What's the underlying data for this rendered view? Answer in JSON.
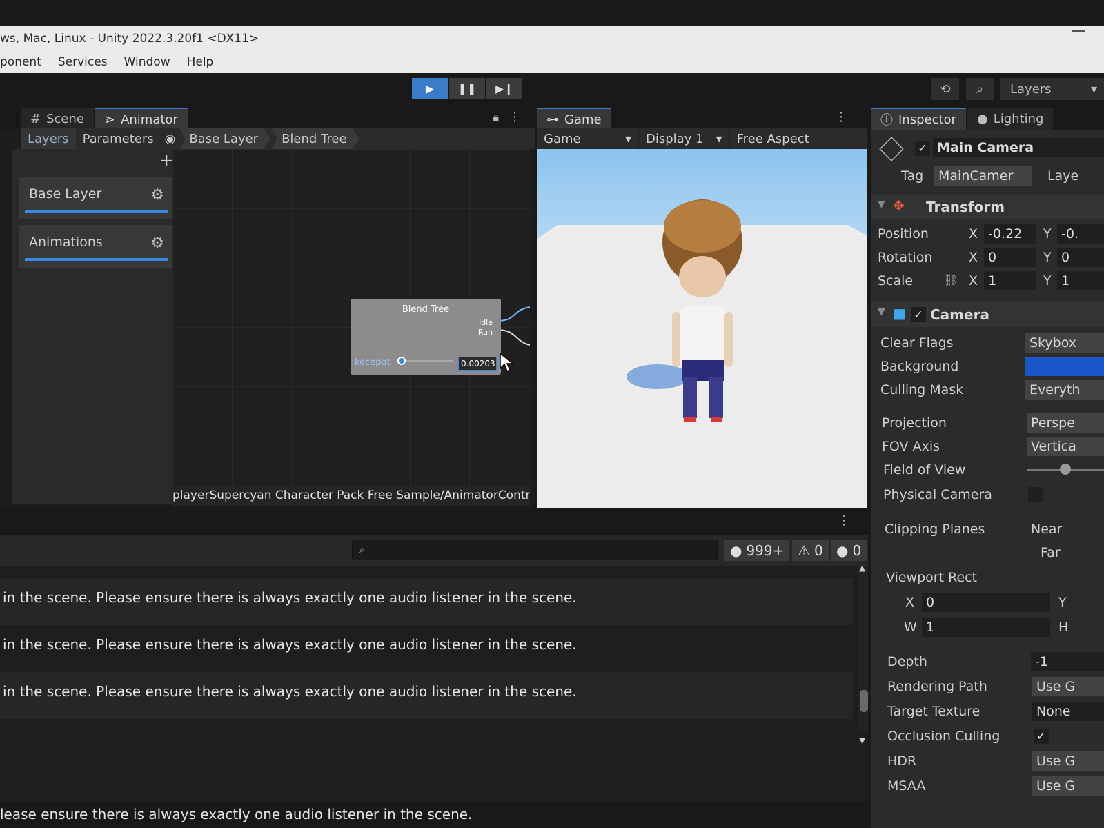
{
  "window": {
    "title": "ws, Mac, Linux - Unity 2022.3.20f1 <DX11>"
  },
  "menu": [
    "ponent",
    "Services",
    "Window",
    "Help"
  ],
  "toolbar": {
    "layers_label": "Layers"
  },
  "animator": {
    "tabs": [
      "Scene",
      "Animator"
    ],
    "subtabs": [
      "Layers",
      "Parameters"
    ],
    "breadcrumbs": [
      "Base Layer",
      "Blend Tree"
    ],
    "layers": [
      "Base Layer",
      "Animations"
    ],
    "node": {
      "title": "Blend Tree",
      "outputs": [
        "Idle",
        "Run"
      ],
      "param_name": "kecepat",
      "param_value": "0.00203"
    },
    "path": "playerSupercyan Character Pack Free Sample/AnimatorContr"
  },
  "game": {
    "tab": "Game",
    "mode": "Game",
    "display": "Display 1",
    "aspect": "Free Aspect"
  },
  "inspector": {
    "tabs": [
      "Inspector",
      "Lighting"
    ],
    "object_name": "Main Camera",
    "tag_label": "Tag",
    "tag_value": "MainCamer",
    "layer_label": "Laye",
    "transform": {
      "title": "Transform",
      "position": {
        "label": "Position",
        "x": "-0.22",
        "y": "-0."
      },
      "rotation": {
        "label": "Rotation",
        "x": "0",
        "y": "0"
      },
      "scale": {
        "label": "Scale",
        "x": "1",
        "y": "1"
      }
    },
    "camera": {
      "title": "Camera",
      "clear_flags": {
        "label": "Clear Flags",
        "value": "Skybox"
      },
      "background": {
        "label": "Background",
        "color": "#1a56c8"
      },
      "culling_mask": {
        "label": "Culling Mask",
        "value": "Everyth"
      },
      "projection": {
        "label": "Projection",
        "value": "Perspe"
      },
      "fov_axis": {
        "label": "FOV Axis",
        "value": "Vertica"
      },
      "field_of_view": {
        "label": "Field of View"
      },
      "physical_camera": {
        "label": "Physical Camera"
      },
      "clipping_planes": {
        "label": "Clipping Planes",
        "near_label": "Near",
        "far_label": "Far"
      },
      "viewport_rect": {
        "label": "Viewport Rect",
        "x": "0",
        "w": "1"
      },
      "depth": {
        "label": "Depth",
        "value": "-1"
      },
      "rendering_path": {
        "label": "Rendering Path",
        "value": "Use G"
      },
      "target_texture": {
        "label": "Target Texture",
        "value": "None"
      },
      "occlusion_culling": {
        "label": "Occlusion Culling"
      },
      "hdr": {
        "label": "HDR",
        "value": "Use G"
      },
      "msaa": {
        "label": "MSAA",
        "value": "Use G"
      }
    }
  },
  "console": {
    "counts": {
      "info": "999+",
      "warnings": "0",
      "errors": "0"
    },
    "logs": [
      " in the scene. Please ensure there is always exactly one audio listener in the scene.",
      " in the scene. Please ensure there is always exactly one audio listener in the scene.",
      " in the scene. Please ensure there is always exactly one audio listener in the scene."
    ],
    "status": "lease ensure there is always exactly one audio listener in the scene."
  }
}
